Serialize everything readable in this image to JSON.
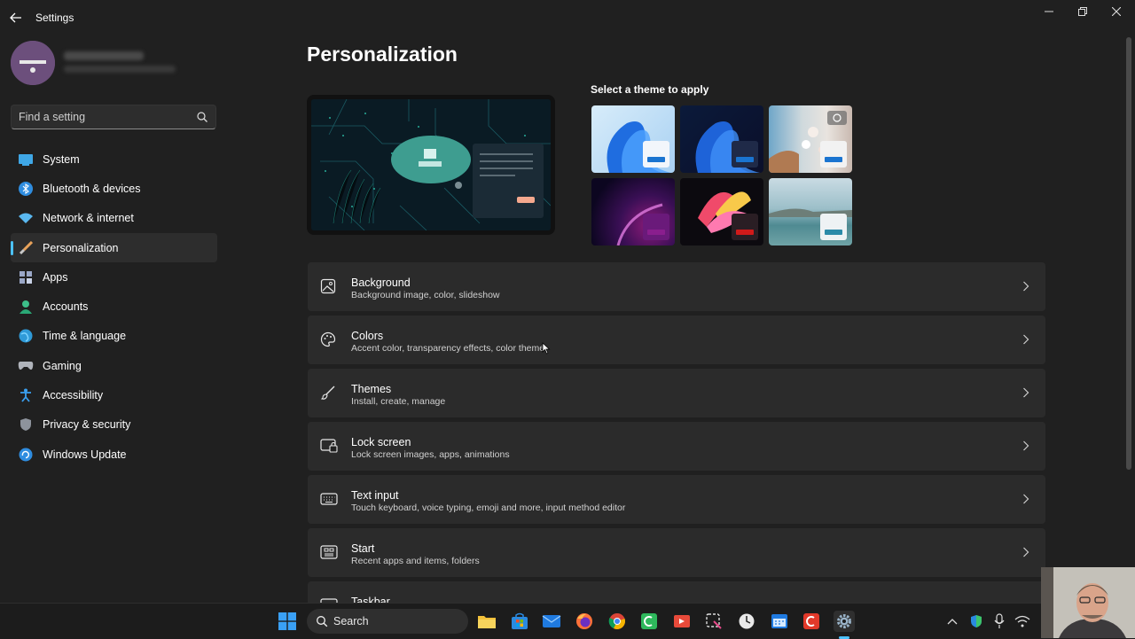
{
  "window": {
    "title": "Settings"
  },
  "sidebar": {
    "search_placeholder": "Find a setting",
    "items": [
      {
        "label": "System",
        "icon": "system-icon"
      },
      {
        "label": "Bluetooth & devices",
        "icon": "bluetooth-icon"
      },
      {
        "label": "Network & internet",
        "icon": "wifi-icon"
      },
      {
        "label": "Personalization",
        "icon": "brush-icon",
        "selected": true
      },
      {
        "label": "Apps",
        "icon": "apps-icon"
      },
      {
        "label": "Accounts",
        "icon": "accounts-icon"
      },
      {
        "label": "Time & language",
        "icon": "globe-icon"
      },
      {
        "label": "Gaming",
        "icon": "gamepad-icon"
      },
      {
        "label": "Accessibility",
        "icon": "accessibility-icon"
      },
      {
        "label": "Privacy & security",
        "icon": "shield-icon"
      },
      {
        "label": "Windows Update",
        "icon": "update-icon"
      }
    ]
  },
  "main": {
    "title": "Personalization",
    "theme_heading": "Select a theme to apply",
    "cards": [
      {
        "title": "Background",
        "subtitle": "Background image, color, slideshow",
        "icon": "image-icon"
      },
      {
        "title": "Colors",
        "subtitle": "Accent color, transparency effects, color theme",
        "icon": "palette-icon"
      },
      {
        "title": "Themes",
        "subtitle": "Install, create, manage",
        "icon": "brush-icon"
      },
      {
        "title": "Lock screen",
        "subtitle": "Lock screen images, apps, animations",
        "icon": "lock-screen-icon"
      },
      {
        "title": "Text input",
        "subtitle": "Touch keyboard, voice typing, emoji and more, input method editor",
        "icon": "keyboard-icon"
      },
      {
        "title": "Start",
        "subtitle": "Recent apps and items, folders",
        "icon": "start-icon"
      },
      {
        "title": "Taskbar",
        "subtitle": "",
        "icon": "taskbar-icon"
      }
    ]
  },
  "taskbar": {
    "search_label": "Search"
  },
  "colors": {
    "accent": "#4cc2ff",
    "background": "#202020",
    "card": "#2b2b2b"
  }
}
